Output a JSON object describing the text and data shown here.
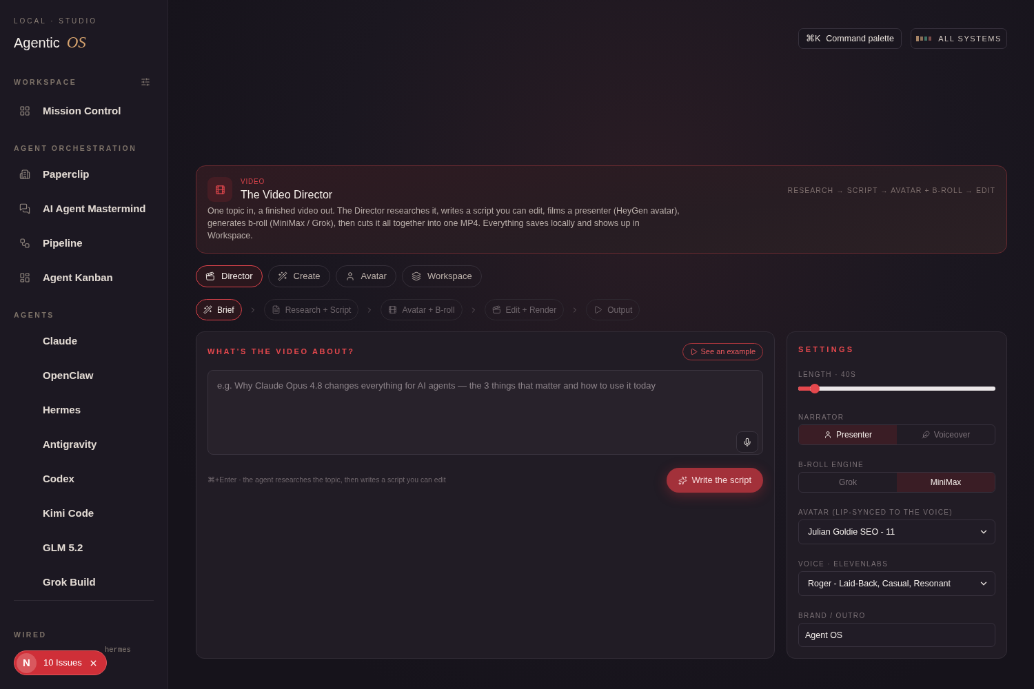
{
  "sidebar": {
    "eyebrow": "LOCAL · STUDIO",
    "brand": {
      "name": "Agentic",
      "mark": "OS"
    },
    "sections": [
      {
        "title": "WORKSPACE",
        "items": [
          "Mission Control"
        ]
      },
      {
        "title": "AGENT ORCHESTRATION",
        "items": [
          "Paperclip",
          "AI Agent Mastermind",
          "Pipeline",
          "Agent Kanban"
        ]
      },
      {
        "title": "AGENTS",
        "items": [
          "Claude",
          "OpenClaw",
          "Hermes",
          "Antigravity",
          "Codex",
          "Kimi Code",
          "GLM 5.2",
          "Grok Build"
        ]
      }
    ],
    "wired": {
      "title": "WIRED",
      "items": [
        "hermes"
      ]
    }
  },
  "topbar": {
    "command_palette": {
      "shortcut": "⌘K",
      "label": "Command palette"
    },
    "status": {
      "label": "ALL SYSTEMS"
    }
  },
  "banner": {
    "eyebrow": "VIDEO",
    "title": "The Video Director",
    "description": "One topic in, a finished video out. The Director researches it, writes a script you can edit, films a presenter (HeyGen avatar), generates b-roll (MiniMax / Grok), then cuts it all together into one MP4. Everything saves locally and shows up in Workspace.",
    "flow": "RESEARCH → SCRIPT → AVATAR + B-ROLL → EDIT"
  },
  "tabs": [
    {
      "label": "Director",
      "selected": true
    },
    {
      "label": "Create",
      "selected": false
    },
    {
      "label": "Avatar",
      "selected": false
    },
    {
      "label": "Workspace",
      "selected": false
    }
  ],
  "steps": [
    {
      "label": "Brief",
      "selected": true
    },
    {
      "label": "Research + Script",
      "selected": false
    },
    {
      "label": "Avatar + B-roll",
      "selected": false
    },
    {
      "label": "Edit + Render",
      "selected": false
    },
    {
      "label": "Output",
      "selected": false
    }
  ],
  "brief": {
    "title": "WHAT'S THE VIDEO ABOUT?",
    "example_button": "See an example",
    "topic": {
      "placeholder": "e.g. Why Claude Opus 4.8 changes everything for AI agents — the 3 things that matter and how to use it today"
    },
    "hint": "⌘+Enter · the agent researches the topic, then writes a script you can edit",
    "submit": "Write the script"
  },
  "settings": {
    "title": "SETTINGS",
    "length": {
      "label": "LENGTH · 40S",
      "level": 0.06
    },
    "narrator": {
      "label": "NARRATOR",
      "options": [
        {
          "label": "Presenter",
          "selected": true
        },
        {
          "label": "Voiceover",
          "selected": false
        }
      ]
    },
    "broll_engine": {
      "label": "B-ROLL ENGINE",
      "options": [
        {
          "label": "Grok",
          "selected": false
        },
        {
          "label": "MiniMax",
          "selected": true
        }
      ]
    },
    "avatar": {
      "label": "AVATAR (LIP-SYNCED TO THE VOICE)",
      "value": "Julian Goldie SEO - 11"
    },
    "voice": {
      "label": "VOICE · ELEVENLABS",
      "value": "Roger - Laid-Back, Casual, Resonant"
    },
    "brand_outro": {
      "label": "BRAND / OUTRO",
      "value": "Agent OS"
    }
  },
  "dev_badge": {
    "logo": "N",
    "label": "10 Issues"
  }
}
